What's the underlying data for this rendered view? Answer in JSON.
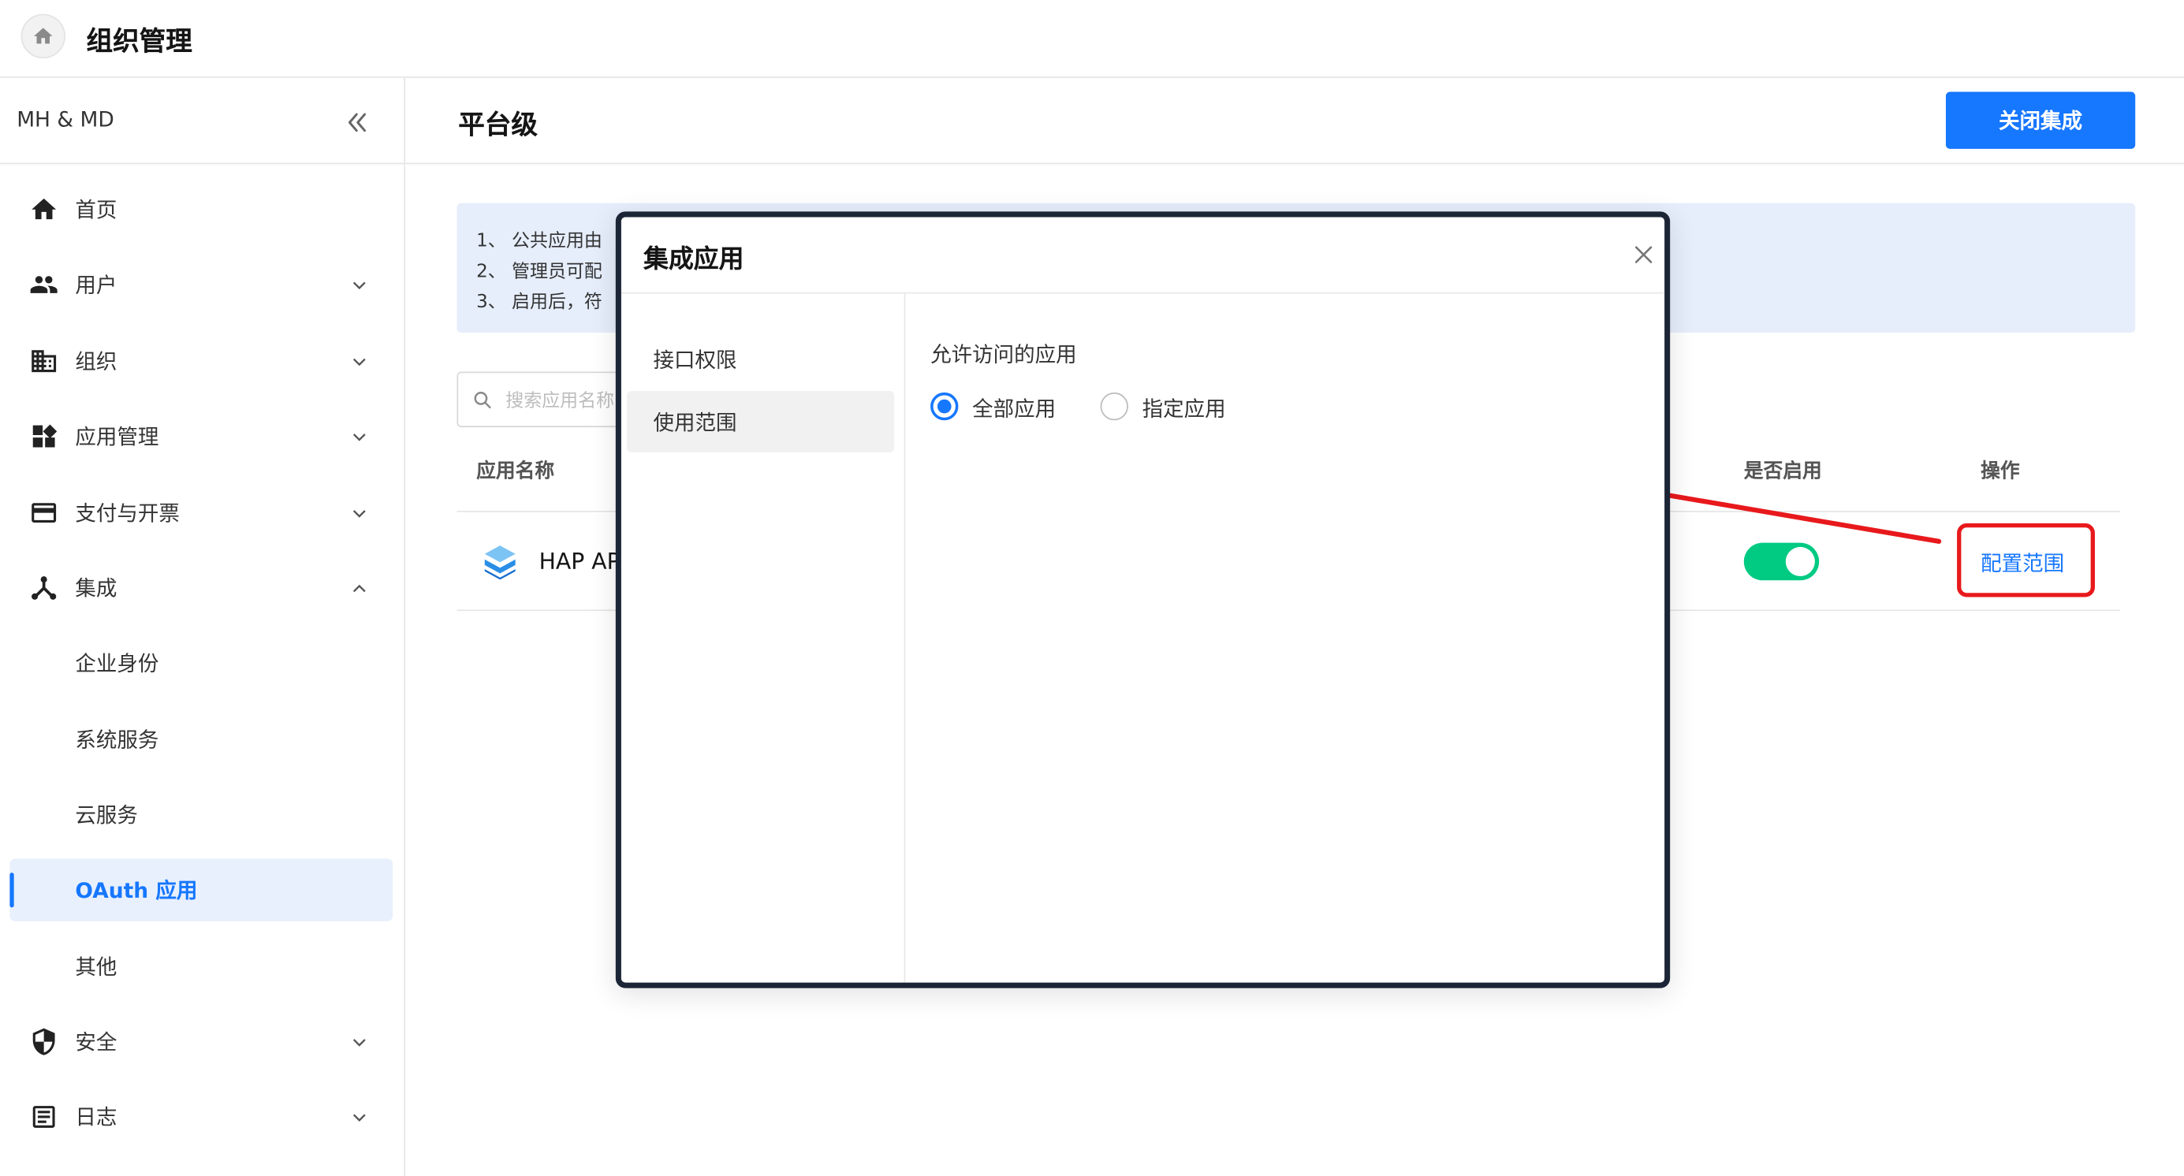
{
  "header": {
    "title": "组织管理",
    "home_icon": "home-icon"
  },
  "sidebar": {
    "org_name": "MH & MD",
    "items": [
      {
        "label": "首页",
        "icon": "home-icon"
      },
      {
        "label": "用户",
        "icon": "users-icon"
      },
      {
        "label": "组织",
        "icon": "building-icon"
      },
      {
        "label": "应用管理",
        "icon": "apps-icon"
      },
      {
        "label": "支付与开票",
        "icon": "card-icon"
      },
      {
        "label": "集成",
        "icon": "integration-icon"
      },
      {
        "label": "企业身份"
      },
      {
        "label": "系统服务"
      },
      {
        "label": "云服务"
      },
      {
        "label": "OAuth 应用"
      },
      {
        "label": "其他"
      },
      {
        "label": "安全",
        "icon": "shield-icon"
      },
      {
        "label": "日志",
        "icon": "log-icon"
      }
    ],
    "active_item": "OAuth 应用"
  },
  "main": {
    "title": "平台级",
    "close_button": "关闭集成",
    "notice": [
      "1、 公共应用由",
      "2、 管理员可配",
      "3、 启用后，符"
    ],
    "search_placeholder": "搜索应用名称",
    "columns": {
      "name": "应用名称",
      "enabled": "是否启用",
      "action": "操作"
    },
    "rows": [
      {
        "name": "HAP API",
        "enabled": true,
        "action": "配置范围"
      }
    ]
  },
  "modal": {
    "title": "集成应用",
    "tabs": [
      "接口权限",
      "使用范围"
    ],
    "selected_tab": "使用范围",
    "section_label": "允许访问的应用",
    "options": [
      "全部应用",
      "指定应用"
    ],
    "selected_option": "全部应用"
  },
  "colors": {
    "accent": "#1677ff",
    "toggle_on": "#01ca83",
    "annotation": "#e8191c",
    "notice_bg": "#e6eefc",
    "modal_border": "#1b2536"
  }
}
